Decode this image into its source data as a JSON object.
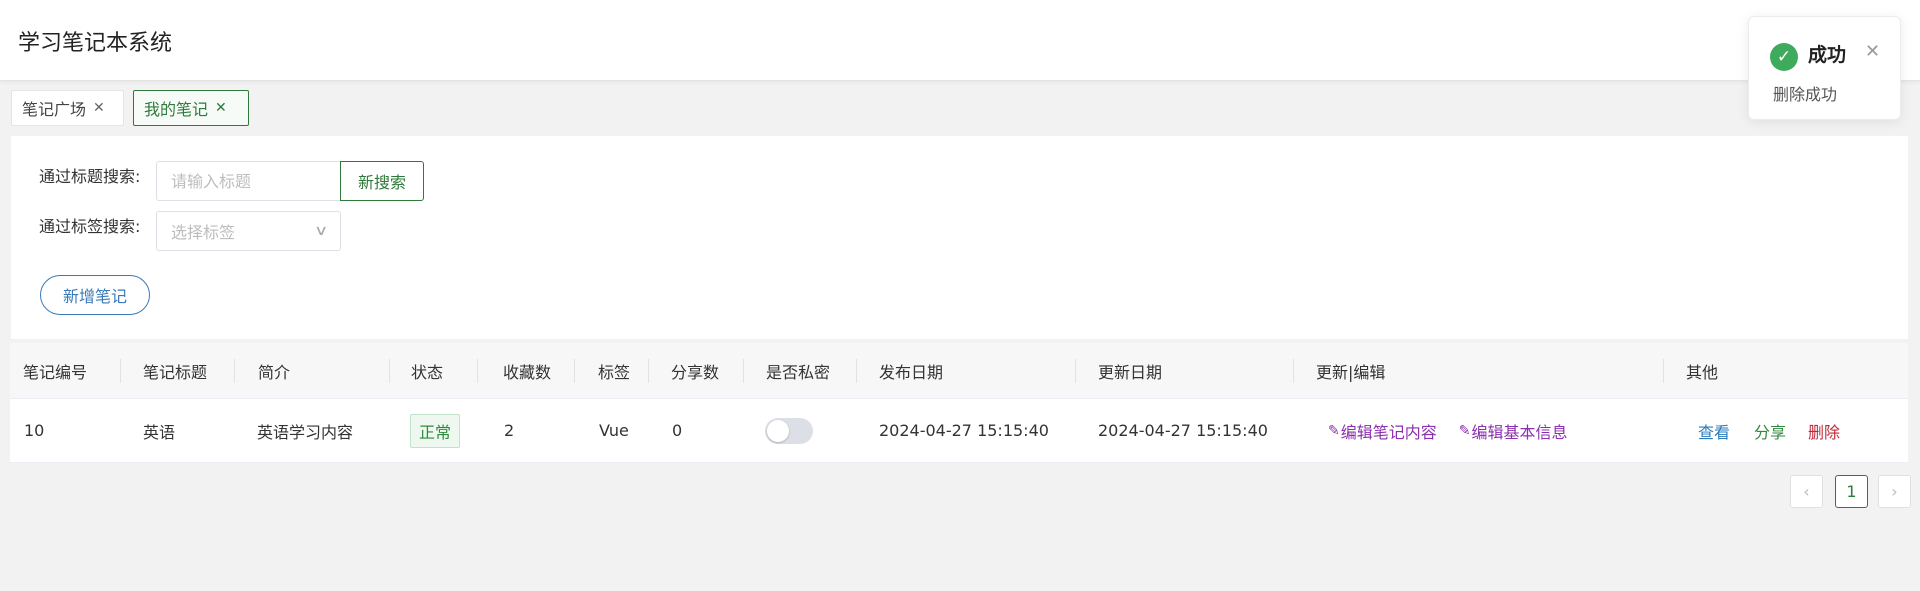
{
  "app": {
    "title": "学习笔记本系统"
  },
  "tabs": [
    {
      "label": "笔记广场",
      "close": "✕",
      "active": false
    },
    {
      "label": "我的笔记",
      "close": "✕",
      "active": true
    }
  ],
  "search": {
    "title_label": "通过标题搜索:",
    "title_placeholder": "请输入标题",
    "search_button": "新搜索",
    "tag_label": "通过标签搜索:",
    "tag_placeholder": "选择标签",
    "chevron_icon": "chevron-down-icon"
  },
  "add_button": "新增笔记",
  "table": {
    "headers": [
      "笔记编号",
      "笔记标题",
      "简介",
      "状态",
      "收藏数",
      "标签",
      "分享数",
      "是否私密",
      "发布日期",
      "更新日期",
      "更新|编辑",
      "其他"
    ],
    "rows": [
      {
        "id": "10",
        "title": "英语",
        "summary": "英语学习内容",
        "status": "正常",
        "favorites": "2",
        "tag": "Vue",
        "shares": "0",
        "private": false,
        "published": "2024-04-27 15:15:40",
        "updated": "2024-04-27 15:15:40",
        "edit_content": "编辑笔记内容",
        "edit_info": "编辑基本信息",
        "view": "查看",
        "share": "分享",
        "delete": "删除"
      }
    ]
  },
  "pagination": {
    "prev": "‹",
    "current": "1",
    "next": "›"
  },
  "notification": {
    "title": "成功",
    "message": "删除成功",
    "icon": "check-circle-icon",
    "close": "✕"
  },
  "colors": {
    "primary_green": "#2f7a3b",
    "blue": "#3a7ab8",
    "purple": "#8c2fb0",
    "red": "#c0283a",
    "success": "#3daa5c"
  }
}
